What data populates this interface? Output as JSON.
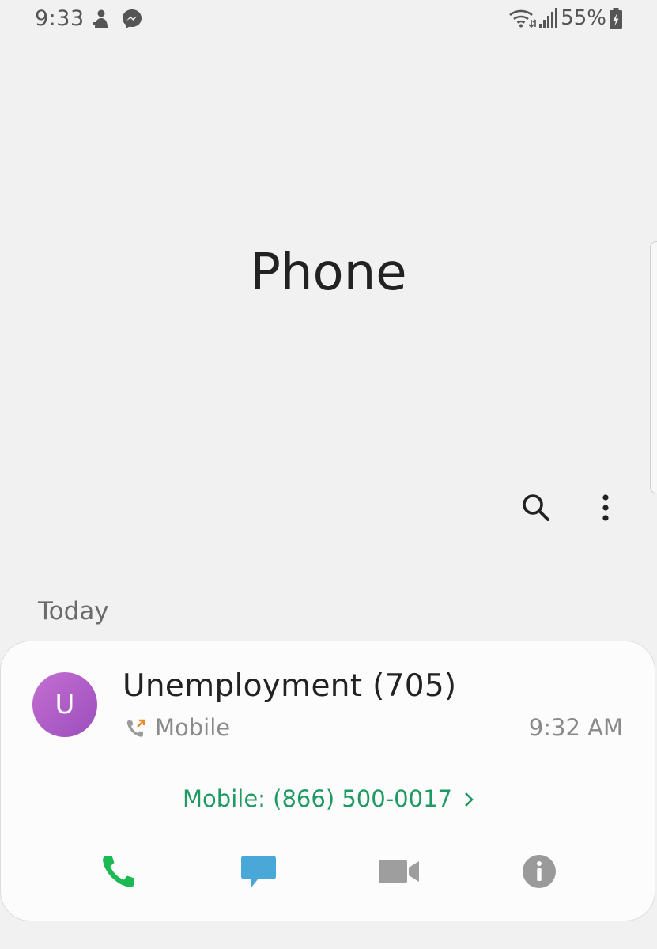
{
  "status_bar": {
    "time": "9:33",
    "battery_percent": "55%",
    "left_icons": [
      "baby-notification-icon",
      "messenger-icon"
    ],
    "right_icons": [
      "wifi-icon",
      "signal-icon",
      "battery-charging-icon"
    ]
  },
  "header": {
    "title": "Phone",
    "toolbar": [
      "search-icon",
      "more-options-icon"
    ]
  },
  "recents": {
    "section_label": "Today",
    "calls": [
      {
        "avatar_initial": "U",
        "name": "Unemployment (705)",
        "call_type": "Mobile",
        "time": "9:32 AM",
        "number_link": "Mobile: (866) 500-0017",
        "actions": [
          "call-icon",
          "message-icon",
          "video-call-icon",
          "info-icon"
        ]
      }
    ]
  },
  "colors": {
    "background": "#f1f1f1",
    "card": "#fcfcfc",
    "accent_green": "#1e9a62",
    "call_green": "#1db954",
    "message_blue": "#4aa8d8",
    "icon_gray": "#9a9a9a",
    "avatar": "#b05ec8"
  }
}
